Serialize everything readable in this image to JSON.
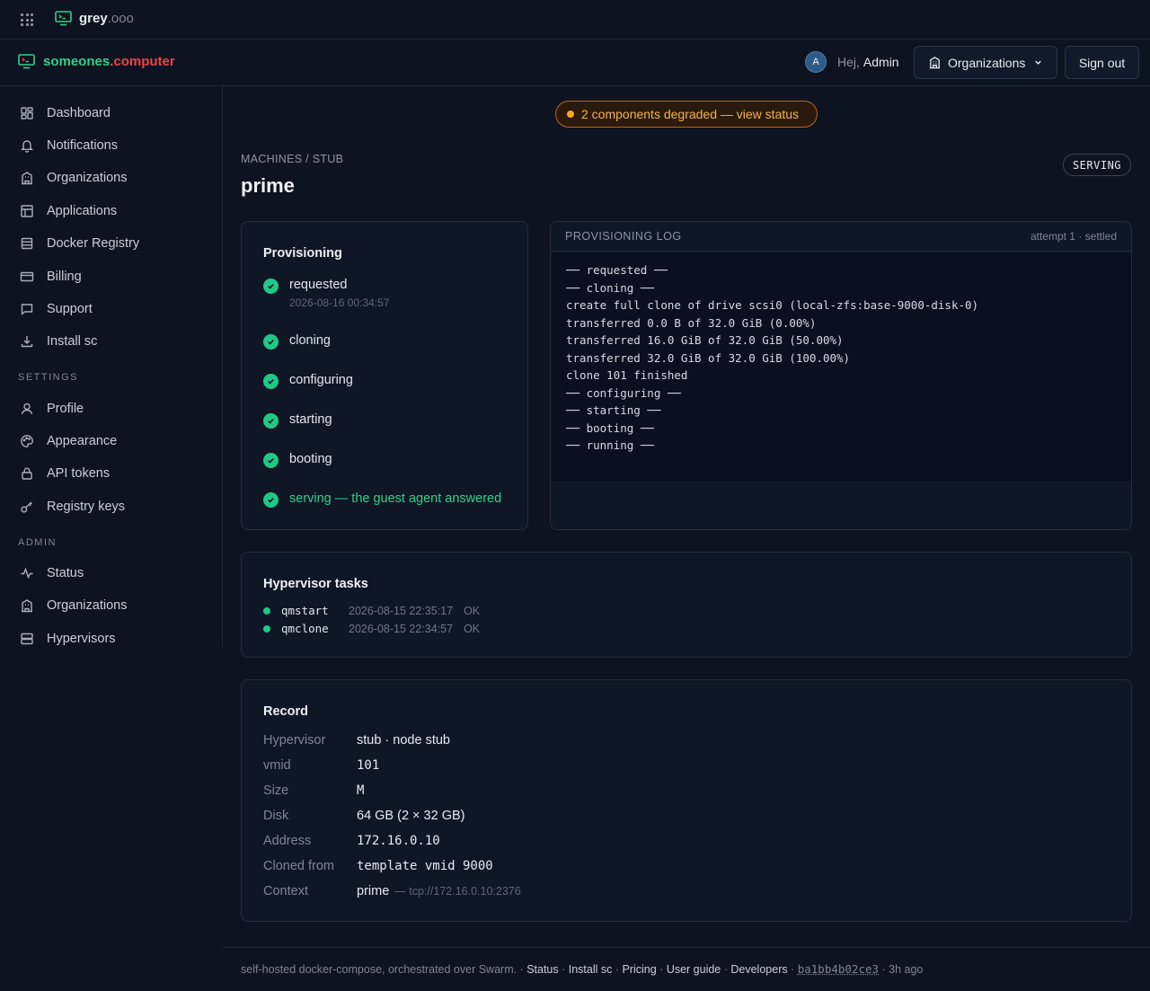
{
  "topbar": {
    "brand_name": "grey",
    "brand_tld": ".ooo"
  },
  "header": {
    "brand_part1": "someones",
    "brand_part2": ".computer",
    "avatar_initial": "A",
    "greeting": "Hej,",
    "user_name": "Admin",
    "orgs_button": "Organizations",
    "signout_button": "Sign out"
  },
  "sidebar": {
    "items": [
      {
        "label": "Dashboard",
        "icon": "dashboard-icon"
      },
      {
        "label": "Notifications",
        "icon": "bell-icon"
      },
      {
        "label": "Organizations",
        "icon": "building-icon"
      },
      {
        "label": "Applications",
        "icon": "layout-icon"
      },
      {
        "label": "Docker Registry",
        "icon": "database-icon"
      },
      {
        "label": "Billing",
        "icon": "credit-card-icon"
      },
      {
        "label": "Support",
        "icon": "chat-icon"
      },
      {
        "label": "Install sc",
        "icon": "download-icon"
      }
    ],
    "settings_label": "SETTINGS",
    "settings_items": [
      {
        "label": "Profile",
        "icon": "user-icon"
      },
      {
        "label": "Appearance",
        "icon": "palette-icon"
      },
      {
        "label": "API tokens",
        "icon": "lock-icon"
      },
      {
        "label": "Registry keys",
        "icon": "key-icon"
      }
    ],
    "admin_label": "ADMIN",
    "admin_items": [
      {
        "label": "Status",
        "icon": "activity-icon"
      },
      {
        "label": "Organizations",
        "icon": "building-icon"
      },
      {
        "label": "Hypervisors",
        "icon": "server-icon"
      }
    ]
  },
  "banner": "2 components degraded — view status",
  "page": {
    "breadcrumb": "MACHINES / STUB",
    "title": "prime",
    "status": "SERVING"
  },
  "provisioning": {
    "title": "Provisioning",
    "steps": [
      {
        "label": "requested",
        "time": "2026-08-16 00:34:57"
      },
      {
        "label": "cloning"
      },
      {
        "label": "configuring"
      },
      {
        "label": "starting"
      },
      {
        "label": "booting"
      },
      {
        "label": "serving — the guest agent answered"
      }
    ]
  },
  "log": {
    "title": "PROVISIONING LOG",
    "meta": "attempt 1 · settled",
    "lines": [
      "── requested ──",
      "── cloning ──",
      "create full clone of drive scsi0 (local-zfs:base-9000-disk-0)",
      "transferred 0.0 B of 32.0 GiB (0.00%)",
      "transferred 16.0 GiB of 32.0 GiB (50.00%)",
      "transferred 32.0 GiB of 32.0 GiB (100.00%)",
      "clone 101 finished",
      "── configuring ──",
      "── starting ──",
      "── booting ──",
      "── running ──"
    ]
  },
  "tasks": {
    "title": "Hypervisor tasks",
    "items": [
      {
        "name": "qmstart",
        "time": "2026-08-15 22:35:17",
        "status": "OK"
      },
      {
        "name": "qmclone",
        "time": "2026-08-15 22:34:57",
        "status": "OK"
      }
    ]
  },
  "record": {
    "title": "Record",
    "rows": [
      {
        "key": "Hypervisor",
        "value": "stub · node stub"
      },
      {
        "key": "vmid",
        "value": "101"
      },
      {
        "key": "Size",
        "value": "M"
      },
      {
        "key": "Disk",
        "value": "64 GB (2 × 32 GB)"
      },
      {
        "key": "Address",
        "value": "172.16.0.10"
      },
      {
        "key": "Cloned from",
        "value": "template vmid 9000"
      },
      {
        "key": "Context",
        "value": "prime",
        "sub": "— tcp://172.16.0.10:2376"
      }
    ]
  },
  "footer": {
    "tagline": "self-hosted docker-compose, orchestrated over Swarm.",
    "links": [
      "Status",
      "Install sc",
      "Pricing",
      "User guide",
      "Developers"
    ],
    "commit": "ba1bb4b02ce3",
    "age": "3h ago"
  },
  "colors": {
    "accent": "#2fd08a",
    "brand_red": "#ef4343",
    "warning": "#f5a623",
    "background": "#0d1320"
  }
}
